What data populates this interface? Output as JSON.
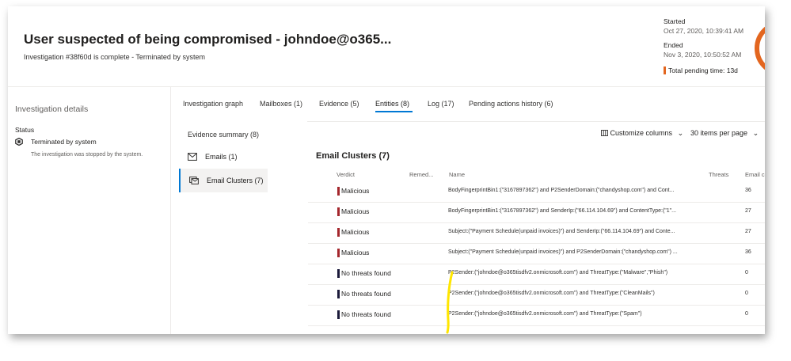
{
  "header": {
    "title": "User suspected of being compromised - johndoe@o365...",
    "subtitle": "Investigation #38f60d is complete - Terminated by system",
    "started_label": "Started",
    "started_value": "Oct 27, 2020, 10:39:41 AM",
    "ended_label": "Ended",
    "ended_value": "Nov 3, 2020, 10:50:52 AM",
    "pending_label": "Total pending time: 13d",
    "accent": "#e3661f"
  },
  "details": {
    "title": "Investigation details",
    "status_label": "Status",
    "status_value": "Terminated by system",
    "status_desc": "The investigation was stopped by the system."
  },
  "tabs": [
    {
      "label": "Investigation graph"
    },
    {
      "label": "Mailboxes  (1)"
    },
    {
      "label": "Evidence  (5)"
    },
    {
      "label": "Entities  (8)",
      "active": true
    },
    {
      "label": "Log (17)"
    },
    {
      "label": "Pending actions history  (6)"
    }
  ],
  "subnav": {
    "title": "Evidence summary (8)",
    "items": [
      {
        "label": "Emails (1)",
        "icon": "mail-icon"
      },
      {
        "label": "Email Clusters (7)",
        "icon": "email-clusters-icon",
        "active": true
      }
    ]
  },
  "toolbar": {
    "customize_label": "Customize columns",
    "items_per_page_label": "30 items per page"
  },
  "section_title": "Email Clusters (7)",
  "table": {
    "columns": [
      "Verdict",
      "Remed...",
      "Name",
      "Threats",
      "Email c"
    ],
    "rows": [
      {
        "verdict": "Malicious",
        "color": "#a4262c",
        "name": "BodyFingerprintBin1:(\"3167897362\") and P2SenderDomain:(\"chandyshop.com\") and Cont...",
        "count": "36"
      },
      {
        "verdict": "Malicious",
        "color": "#a4262c",
        "name": "BodyFingerprintBin1:(\"3167897362\") and SenderIp:(\"66.114.104.69\") and ContentType:(\"1\"...",
        "count": "27"
      },
      {
        "verdict": "Malicious",
        "color": "#a4262c",
        "name": "Subject:(\"Payment Schedule(unpaid invoices)\") and SenderIp:(\"66.114.104.69\") and Conte...",
        "count": "27"
      },
      {
        "verdict": "Malicious",
        "color": "#a4262c",
        "name": "Subject:(\"Payment Schedule(unpaid invoices)\") and P2SenderDomain:(\"chandyshop.com\") ...",
        "count": "36"
      },
      {
        "verdict": "No threats found",
        "color": "#1b1a3a",
        "name": "P2Sender:(\"johndoe@o365tisdfv2.onmicrosoft.com\") and ThreatType:(\"Malware\",\"Phish\")",
        "count": "0"
      },
      {
        "verdict": "No threats found",
        "color": "#1b1a3a",
        "name": "P2Sender:(\"johndoe@o365tisdfv2.onmicrosoft.com\") and ThreatType:(\"CleanMails\")",
        "count": "0"
      },
      {
        "verdict": "No threats found",
        "color": "#1b1a3a",
        "name": "P2Sender:(\"johndoe@o365tisdfv2.onmicrosoft.com\") and ThreatType:(\"Spam\")",
        "count": "0"
      }
    ]
  },
  "annotation_color": "#ffe600"
}
